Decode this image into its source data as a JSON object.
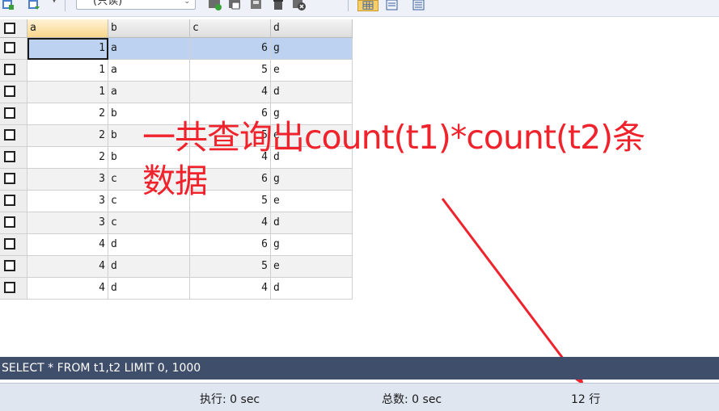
{
  "toolbar": {
    "combo_value": "(只读)",
    "combo_arrow": "⌄"
  },
  "grid": {
    "columns": [
      "a",
      "b",
      "c",
      "d"
    ],
    "rows": [
      [
        "1",
        "a",
        "6",
        "g"
      ],
      [
        "1",
        "a",
        "5",
        "e"
      ],
      [
        "1",
        "a",
        "4",
        "d"
      ],
      [
        "2",
        "b",
        "6",
        "g"
      ],
      [
        "2",
        "b",
        "5",
        "e"
      ],
      [
        "2",
        "b",
        "4",
        "d"
      ],
      [
        "3",
        "c",
        "6",
        "g"
      ],
      [
        "3",
        "c",
        "5",
        "e"
      ],
      [
        "3",
        "c",
        "4",
        "d"
      ],
      [
        "4",
        "d",
        "6",
        "g"
      ],
      [
        "4",
        "d",
        "5",
        "e"
      ],
      [
        "4",
        "d",
        "4",
        "d"
      ]
    ]
  },
  "annotation": {
    "text": "一共查询出count(t1)*count(t2)条数据",
    "color": "#f0222b"
  },
  "sql_bar": {
    "query": "SELECT * FROM t1,t2 LIMIT 0, 1000"
  },
  "status_bar": {
    "exec_time": "执行: 0 sec",
    "total_time": "总数: 0 sec",
    "row_count": "12 行"
  }
}
